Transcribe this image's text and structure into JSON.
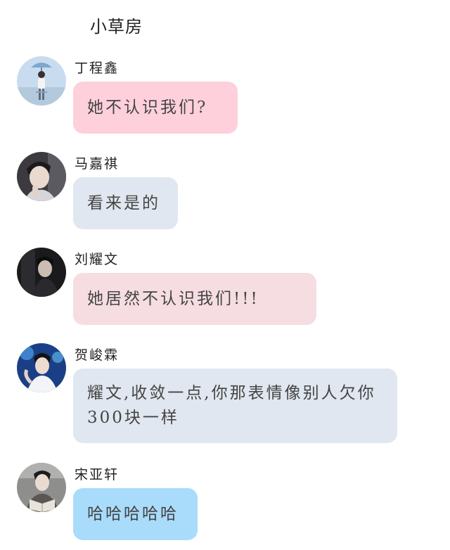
{
  "header": {
    "title": "小草房"
  },
  "messages": [
    {
      "sender": "丁程鑫",
      "text": "她不认识我们?",
      "bubble_color": "#fdd0dc",
      "avatar_icon": "person-with-umbrella-avatar"
    },
    {
      "sender": "马嘉祺",
      "text": "看来是的",
      "bubble_color": "#e1e7f0",
      "avatar_icon": "person-portrait-avatar"
    },
    {
      "sender": "刘耀文",
      "text": "她居然不认识我们!!!",
      "bubble_color": "#f5dde2",
      "avatar_icon": "person-dark-avatar"
    },
    {
      "sender": "贺峻霖",
      "text": "耀文,收敛一点,你那表情像别人欠你300块一样",
      "bubble_color": "#e1e7f0",
      "avatar_icon": "person-stage-avatar"
    },
    {
      "sender": "宋亚轩",
      "text": "哈哈哈哈哈",
      "bubble_color": "#a9dcfb",
      "avatar_icon": "person-reading-avatar"
    }
  ]
}
